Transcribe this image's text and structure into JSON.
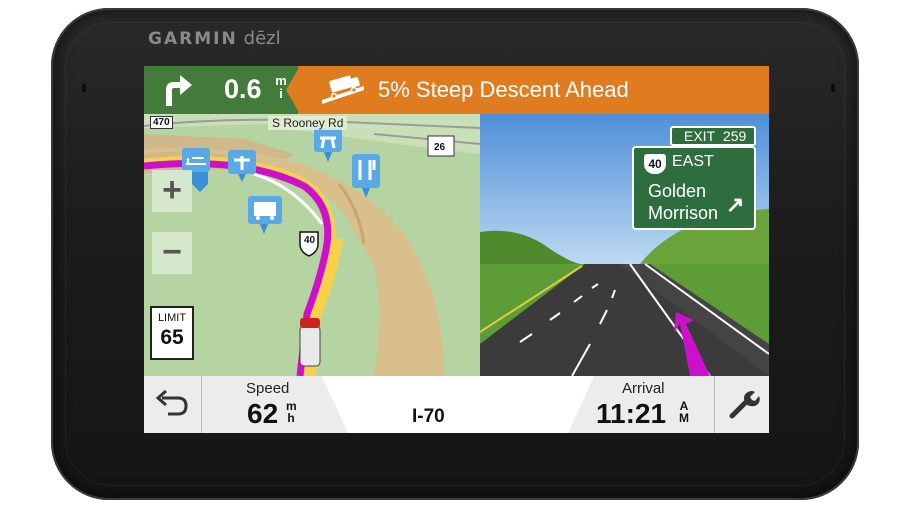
{
  "device": {
    "brand": "GARMIN",
    "model": "dēzl",
    "bezel_color": "#1f1f1f"
  },
  "banner": {
    "turn_icon": "turn-right-arrow-icon",
    "distance_value": "0.6",
    "distance_unit_top": "m",
    "distance_unit_bottom": "i",
    "warning_icon": "steep-descent-truck-icon",
    "warning_text": "5% Steep Descent Ahead",
    "turn_color": "#437b3a",
    "warning_color": "#e07c20"
  },
  "map": {
    "street_name": "S Rooney Rd",
    "road_shields": [
      "470",
      "26",
      "40"
    ],
    "zoom_in_label": "+",
    "zoom_out_label": "−",
    "speed_limit_label": "LIMIT",
    "speed_limit_value": "65",
    "poi_icons": [
      "lodging-icon",
      "rest-area-icon",
      "picnic-icon",
      "restaurant-icon",
      "truck-stop-icon"
    ],
    "route_color": "#cc11cc"
  },
  "junction": {
    "exit_label": "EXIT",
    "exit_number": "259",
    "route_shield": "40",
    "direction": "EAST",
    "destinations": [
      "Golden",
      "Morrison"
    ],
    "arrow": "↗"
  },
  "bottom_bar": {
    "back_icon": "back-arrow-icon",
    "speed_label": "Speed",
    "speed_value": "62",
    "speed_unit_top": "m",
    "speed_unit_bottom": "h",
    "road_name": "I-70",
    "arrival_label": "Arrival",
    "arrival_value": "11:21",
    "arrival_unit_top": "A",
    "arrival_unit_bottom": "M",
    "tools_icon": "wrench-icon"
  }
}
